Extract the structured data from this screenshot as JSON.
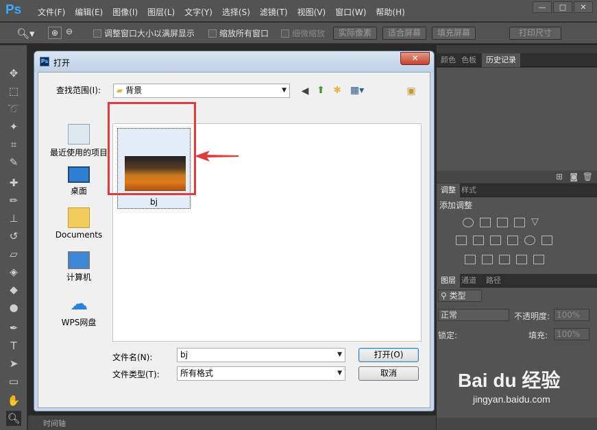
{
  "app": {
    "logo": "Ps"
  },
  "menu": [
    "文件(F)",
    "编辑(E)",
    "图像(I)",
    "图层(L)",
    "文字(Y)",
    "选择(S)",
    "滤镜(T)",
    "视图(V)",
    "窗口(W)",
    "帮助(H)"
  ],
  "window_controls": {
    "minimize": "—",
    "maximize": "□",
    "close": "✕"
  },
  "options": {
    "resize_windows": "调整窗口大小以满屏显示",
    "zoom_all": "缩放所有窗口",
    "scrubby": "细微缩放",
    "actual_pixels": "实际像素",
    "fit_screen": "适合屏幕",
    "fill_screen": "填充屏幕",
    "print_size": "打印尺寸"
  },
  "panels": {
    "tabs1": [
      "颜色",
      "色板",
      "历史记录"
    ],
    "tabs2": [
      "调整",
      "样式"
    ],
    "adjust_title": "添加调整",
    "tabs3": [
      "图层",
      "通道",
      "路径"
    ],
    "kind": "类型",
    "blend": "正常",
    "opacity_label": "不透明度:",
    "opacity_value": "100%",
    "lock_label": "锁定:",
    "fill_label": "填充:",
    "fill_value": "100%"
  },
  "timeline": "时间轴",
  "dialog": {
    "title": "打开",
    "close": "✕",
    "look_in_label": "查找范围(I):",
    "look_in_value": "背景",
    "places": [
      "最近使用的项目",
      "桌面",
      "Documents",
      "计算机",
      "WPS网盘"
    ],
    "file_name": "bj",
    "filename_label": "文件名(N):",
    "filename_value": "bj",
    "filetype_label": "文件类型(T):",
    "filetype_value": "所有格式",
    "open_btn": "打开(O)",
    "cancel_btn": "取消"
  },
  "watermark": {
    "brand": "Bai du 经验",
    "url": "jingyan.baidu.com"
  },
  "colors": {
    "accent_red": "#e23a3a",
    "ps_blue": "#3da9ff"
  }
}
